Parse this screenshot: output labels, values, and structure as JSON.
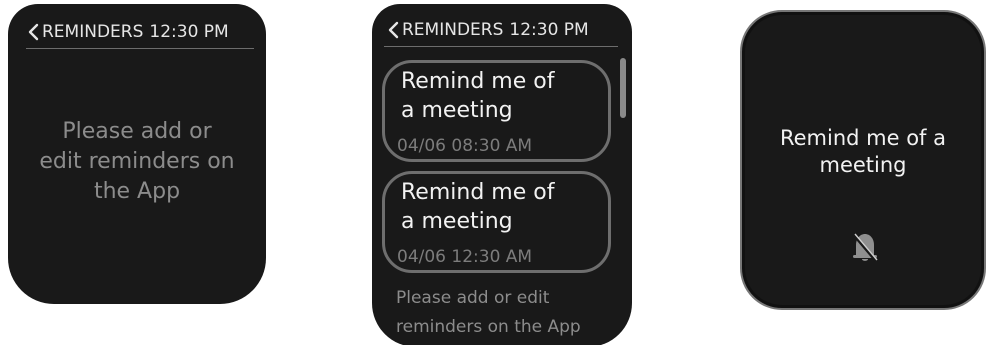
{
  "screen1": {
    "header": {
      "back_glyph": "<",
      "title": "REMINDERS",
      "time": "12:30 PM"
    },
    "empty_message_line1": "Please add or",
    "empty_message_line2": "edit reminders on",
    "empty_message_line3": "the App"
  },
  "screen2": {
    "header": {
      "back_glyph": "<",
      "title": "REMINDERS",
      "time": "12:30 PM"
    },
    "reminders": [
      {
        "title_line1": "Remind me of",
        "title_line2": "a meeting",
        "time": "04/06 08:30 AM"
      },
      {
        "title_line1": "Remind me of",
        "title_line2": "a meeting",
        "time": "04/06 12:30 AM"
      }
    ],
    "empty_message_line1": "Please add or edit",
    "empty_message_line2": "reminders on the App"
  },
  "screen3": {
    "alert_title_line1": "Remind me of a",
    "alert_title_line2": "meeting",
    "icon": "bell-muted-icon"
  },
  "colors": {
    "screen_bg": "#191919",
    "text_primary": "#f2f2f2",
    "text_muted": "#8c8c8c",
    "card_border": "#6e6e6e"
  }
}
